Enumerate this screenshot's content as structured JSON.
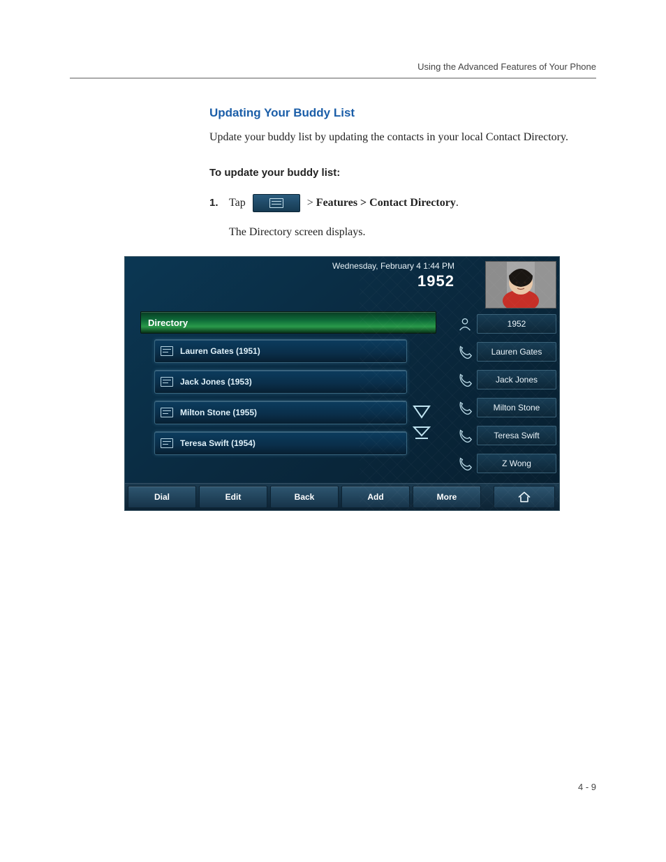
{
  "page": {
    "header": "Using the Advanced Features of Your Phone",
    "footer": "4 - 9"
  },
  "section": {
    "heading": "Updating Your Buddy List",
    "intro": "Update your buddy list by updating the contacts in your local Contact Directory.",
    "sub": "To update your buddy list:",
    "step1_num": "1.",
    "step1_lead": "Tap",
    "step1_tail_prefix": " > ",
    "step1_tail_bold": "Features > Contact Directory",
    "step1_tail_suffix": ".",
    "step1_result": "The Directory screen displays."
  },
  "phone": {
    "datetime": "Wednesday, February 4  1:44 PM",
    "extension": "1952",
    "screen_title": "Directory",
    "contacts": [
      "Lauren Gates (1951)",
      "Jack Jones (1953)",
      "Milton Stone (1955)",
      "Teresa Swift (1954)"
    ],
    "speed_dials": [
      "1952",
      "Lauren Gates",
      "Jack Jones",
      "Milton Stone",
      "Teresa Swift",
      "Z Wong"
    ],
    "softkeys": [
      "Dial",
      "Edit",
      "Back",
      "Add",
      "More"
    ]
  }
}
